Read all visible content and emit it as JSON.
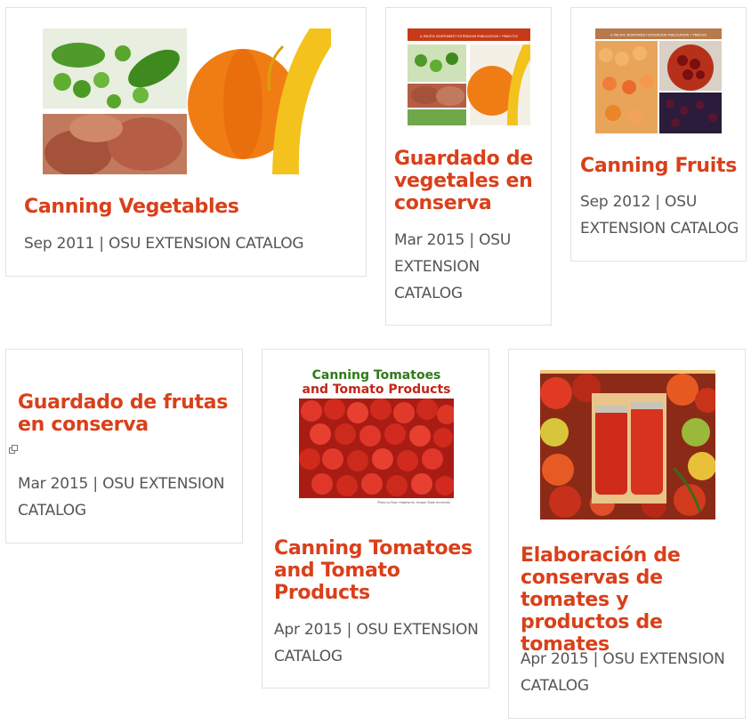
{
  "cards": [
    {
      "title": "Canning Vegetables",
      "meta": "Sep 2011 | OSU EXTENSION CATALOG",
      "image": "canning-vegetables-cover"
    },
    {
      "title": "Guardado de vegetales en conserva",
      "meta": "Mar 2015 | OSU EXTENSION CATALOG",
      "image": "guardado-vegetales-cover",
      "cover_banner": "A PACIFIC NORTHWEST EXTENSION PUBLICATION • PNW172S"
    },
    {
      "title": "Canning Fruits",
      "meta": "Sep 2012 | OSU EXTENSION CATALOG",
      "image": "canning-fruits-cover",
      "cover_banner": "A PACIFIC NORTHWEST EXTENSION PUBLICATION • PNW199"
    },
    {
      "title": "Guardado de frutas en conserva",
      "meta": "Mar 2015 | OSU EXTENSION CATALOG",
      "image": null,
      "icon": "external-link-icon"
    },
    {
      "title": "Canning Tomatoes and Tomato Products",
      "meta": "Apr 2015 | OSU EXTENSION CATALOG",
      "image": "canning-tomatoes-cover",
      "cover_heading_1": "Canning Tomatoes",
      "cover_heading_2": "and Tomato Products",
      "cover_credit": "Photo by Ryan Hawthorne, Oregon State University"
    },
    {
      "title": "Elaboración de conservas de tomates y productos de tomates",
      "meta": "Apr 2015 | OSU EXTENSION CATALOG",
      "image": "elaboracion-tomates-cover"
    }
  ],
  "colors": {
    "title": "#d9401a",
    "meta": "#555555",
    "border": "#e2e2e2"
  }
}
